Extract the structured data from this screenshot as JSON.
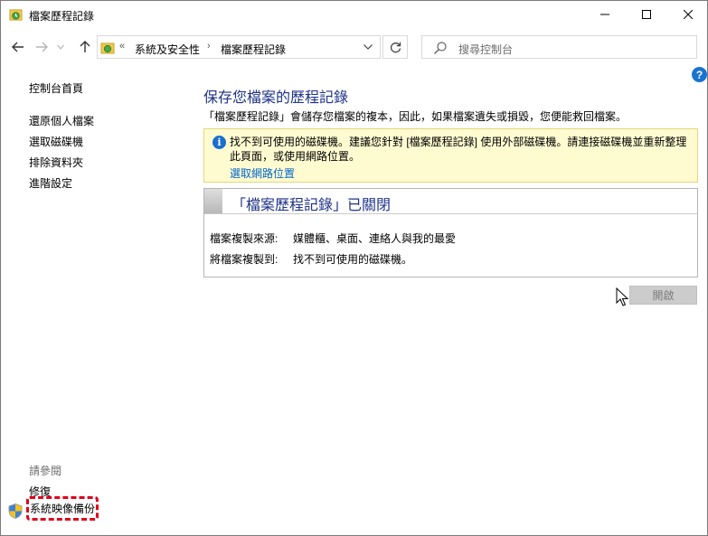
{
  "window": {
    "title": "檔案歷程記錄",
    "title_icon": "file-history-icon"
  },
  "nav": {
    "overflow_chevron": "«",
    "breadcrumb": [
      "系統及安全性",
      "檔案歷程記錄"
    ],
    "separator": "›",
    "search_placeholder": "搜尋控制台"
  },
  "sidebar": {
    "home": "控制台首頁",
    "links": [
      "還原個人檔案",
      "選取磁碟機",
      "排除資料夾",
      "進階設定"
    ],
    "see_also_heading": "請參閱",
    "see_also": [
      "修復",
      "系統映像備份"
    ]
  },
  "main": {
    "title": "保存您檔案的歷程記錄",
    "description": "「檔案歷程記錄」會儲存您檔案的複本，因此，如果檔案遺失或損毀，您便能救回檔案。",
    "warning": {
      "icon": "info-icon",
      "text": "找不到可使用的磁碟機。建議您針對 [檔案歷程記錄] 使用外部磁碟機。請連接磁碟機並重新整理此頁面，或使用網路位置。",
      "link": "選取網路位置"
    },
    "status": {
      "title": "「檔案歷程記錄」已關閉",
      "rows": [
        {
          "label": "檔案複製來源:",
          "value": "媒體櫃、桌面、連絡人與我的最愛"
        },
        {
          "label": "將檔案複製到:",
          "value": "找不到可使用的磁碟機。"
        }
      ]
    },
    "open_button": "開啟"
  },
  "colors": {
    "heading_blue": "#1e3287",
    "link_blue": "#0066cc",
    "warning_bg": "#fffbd1",
    "highlight_red": "#e0001b"
  }
}
